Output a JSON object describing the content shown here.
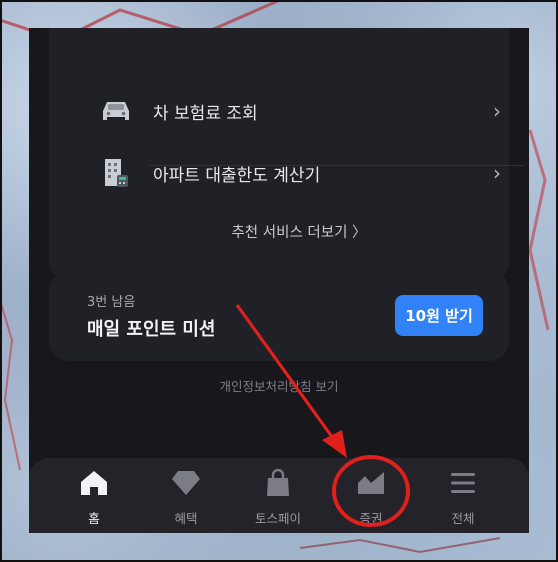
{
  "services": {
    "items": [
      {
        "label": "차 보험료 조회",
        "icon": "car-icon"
      },
      {
        "label": "아파트 대출한도 계산기",
        "icon": "apartment-calculator-icon"
      }
    ],
    "more_label": "추천 서비스 더보기 〉"
  },
  "mission": {
    "remaining": "3번 남음",
    "title": "매일 포인트 미션",
    "button_label": "10원 받기"
  },
  "privacy_link": "개인정보처리방침 보기",
  "tabbar": {
    "tabs": [
      {
        "label": "홈",
        "icon": "home-icon",
        "active": true
      },
      {
        "label": "혜택",
        "icon": "diamond-icon",
        "active": false
      },
      {
        "label": "토스페이",
        "icon": "shopping-bag-icon",
        "active": false
      },
      {
        "label": "증권",
        "icon": "stock-chart-icon",
        "active": false
      },
      {
        "label": "전체",
        "icon": "menu-icon",
        "active": false
      }
    ]
  },
  "annotation": {
    "arrow_color": "#e0201c",
    "circle_color": "#e0201c",
    "highlighted_tab": "증권"
  },
  "colors": {
    "accent": "#3182f6",
    "background": "#17171c",
    "card": "#202027"
  }
}
